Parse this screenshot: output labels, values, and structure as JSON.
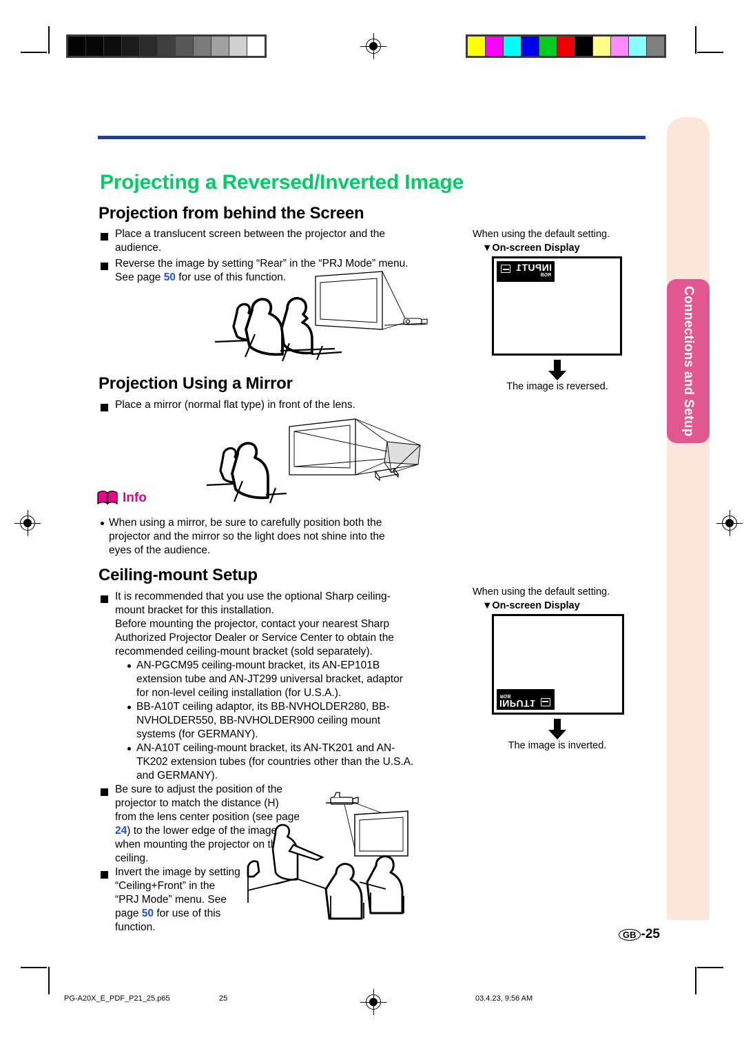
{
  "document": {
    "title": "Projecting a Reversed/Inverted Image",
    "title_color": "#00cc66",
    "rule_color": "#1f3da8",
    "page_label_region": "GB",
    "page_label_number": "-25"
  },
  "side_tab": {
    "label": "Connections and Setup",
    "bg_color": "#e0588f",
    "panel_color": "#fde6da"
  },
  "sections": {
    "rear": {
      "heading": "Projection from behind the Screen",
      "bullets": [
        "Place a translucent screen between the projector and the audience.",
        "Reverse the image by setting “Rear” in the “PRJ Mode” menu. See page 50 for use of this function."
      ],
      "bullet1_line1": "Place a translucent screen between the projector and the",
      "bullet1_line2": "audience.",
      "bullet2_line1": "Reverse the image by setting “Rear” in the “PRJ Mode” menu.",
      "bullet2_pre": "See page ",
      "bullet2_page": "50",
      "bullet2_post": " for use of this function."
    },
    "mirror": {
      "heading": "Projection Using a Mirror",
      "bullet1": "Place a mirror (normal flat type) in front of the lens."
    },
    "info": {
      "label": "Info",
      "label_color": "#ec008c",
      "line1": "When using a mirror, be sure to carefully position both the",
      "line2": "projector and the mirror so the light does not shine into the",
      "line3": "eyes of the audience."
    },
    "ceiling": {
      "heading": "Ceiling-mount Setup",
      "b1_l1": "It is recommended that you use the optional Sharp ceiling-",
      "b1_l2": "mount bracket for this installation.",
      "b1_l3": "Before mounting the projector, contact your nearest Sharp",
      "b1_l4": "Authorized Projector Dealer or Service Center to obtain the",
      "b1_l5": "recommended ceiling-mount bracket (sold separately).",
      "sub1_l1": "AN-PGCM95 ceiling-mount bracket, its AN-EP101B",
      "sub1_l2": "extension tube and AN-JT299 universal bracket, adaptor",
      "sub1_l3": "for non-level ceiling installation (for U.S.A.).",
      "sub2_l1": "BB-A10T ceiling adaptor, its BB-NVHOLDER280, BB-",
      "sub2_l2": "NVHOLDER550, BB-NVHOLDER900 ceiling mount",
      "sub2_l3": "systems (for GERMANY).",
      "sub3_l1": "AN-A10T ceiling-mount bracket, its AN-TK201 and AN-",
      "sub3_l2": "TK202 extension tubes (for countries other than the U.S.A.",
      "sub3_l3": "and GERMANY).",
      "b2_l1": "Be sure to adjust the position of the",
      "b2_l2": "projector to match the distance (H)",
      "b2_l3": "from the lens center position (see page",
      "b2_l4_page": "24",
      "b2_l4_post": ") to the lower edge of the image,",
      "b2_l5": "when mounting the projector on the",
      "b2_l6": "ceiling.",
      "b3_l1": "Invert the image by setting",
      "b3_l2": "“Ceiling+Front” in the",
      "b3_l3": "“PRJ Mode” menu. See",
      "b3_l4_pre": "page ",
      "b3_l4_page": "50",
      "b3_l4_post": " for use of this",
      "b3_l5": "function."
    }
  },
  "osd_panels": [
    {
      "note": "When using the default setting.",
      "sub_label": "▼On-screen Display",
      "badge_main": "INPUT1",
      "badge_sub": "RGB",
      "caption": "The image is reversed.",
      "flip": "horizontal"
    },
    {
      "note": "When using the default setting.",
      "sub_label": "▼On-screen Display",
      "badge_main": "INPUT1",
      "badge_sub": "RGB",
      "caption": "The image is inverted.",
      "flip": "vertical"
    }
  ],
  "calibration": {
    "grayscale": [
      "#030303",
      "#060606",
      "#0d0d0d",
      "#1b1b1b",
      "#2b2b2b",
      "#3f3f3f",
      "#575757",
      "#7b7b7b",
      "#a0a0a0",
      "#cfcfcf",
      "#ffffff"
    ],
    "colors": [
      "#ffff00",
      "#ff00ff",
      "#00ffff",
      "#0000ee",
      "#00cc22",
      "#ee0000",
      "#000000",
      "#ffff88",
      "#ff88ff",
      "#88ffff",
      "#808080"
    ]
  },
  "footer": {
    "filename": "PG-A20X_E_PDF_P21_25.p65",
    "page": "25",
    "timestamp": "03.4.23, 9:56 AM"
  }
}
